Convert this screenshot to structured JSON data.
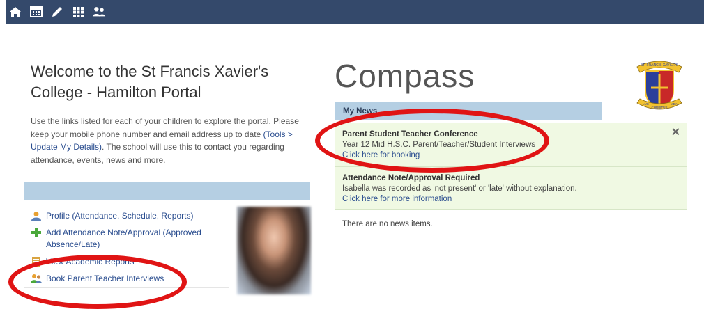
{
  "nav": {
    "icons": [
      "home-icon",
      "calendar-icon",
      "pencil-icon",
      "grid-icon",
      "people-icon"
    ]
  },
  "welcome": {
    "title": "Welcome to the St Francis Xavier's College - Hamilton Portal",
    "intro_prefix": "Use the links listed for each of your children to explore the portal. Please keep your mobile phone number and email address up to date ",
    "intro_link": "(Tools > Update My Details)",
    "intro_suffix": ". The school will use this to contact you regarding attendance, events, news and more."
  },
  "links": [
    {
      "label": "Profile (Attendance, Schedule, Reports)",
      "icon": "profile-icon"
    },
    {
      "label": "Add Attendance Note/Approval (Approved Absence/Late)",
      "icon": "plus-icon"
    },
    {
      "label": "View Academic Reports",
      "icon": "report-icon"
    },
    {
      "label": "Book Parent Teacher Interviews",
      "icon": "meeting-icon"
    }
  ],
  "compass": {
    "title": "Compass"
  },
  "crest": {
    "top_text": "ST. FRANCIS XAVIER'S",
    "motto_left": "LUX",
    "motto_center": "CHRISTUS",
    "motto_right": "MEA"
  },
  "news": {
    "header": "My News",
    "alerts": [
      {
        "title": "Parent Student Teacher Conference",
        "desc": "Year 12 Mid H.S.C. Parent/Teacher/Student Interviews",
        "link": "Click here for booking",
        "dismissable": true
      },
      {
        "title": "Attendance Note/Approval Required",
        "desc": "Isabella was recorded as 'not present' or 'late' without explanation.",
        "link": "Click here for more information",
        "dismissable": false
      }
    ],
    "empty_text": "There are no news items."
  },
  "colors": {
    "topbar": "#34496b",
    "band": "#b5cfe3",
    "alert_bg": "#f0f9e3",
    "link": "#2a4d8f",
    "annotation": "#e01414"
  }
}
